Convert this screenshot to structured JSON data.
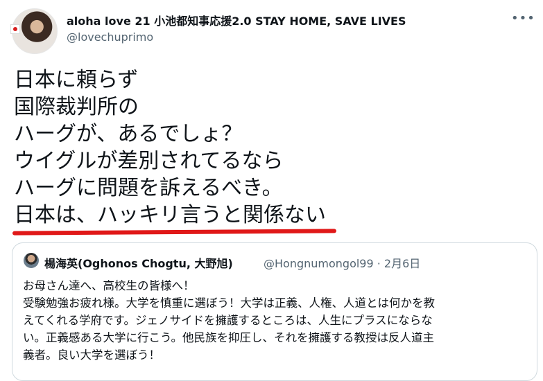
{
  "author": {
    "display_name": "aloha love 21 小池都知事応援2.0 STAY HOME, SAVE LIVES",
    "handle": "@lovechuprimo",
    "more_icon": "more-horizontal-icon"
  },
  "tweet": {
    "lines": [
      "日本に頼らず",
      "国際裁判所の",
      "ハーグが、あるでしょ？",
      "ウイグルが差別されてるなら",
      "ハーグに問題を訴えるべき。",
      "日本は、ハッキリ言うと関係ない"
    ],
    "underline_color": "#e01818"
  },
  "quoted": {
    "display_name": "楊海英(Oghonos Chogtu, 大野旭)",
    "meta": "@Hongnumongol99 · 2月6日",
    "lines": [
      "お母さん達へ、高校生の皆様へ！",
      "受験勉強お疲れ様。大学を慎重に選ぼう！大学は正義、人権、人道とは何かを教",
      "えてくれる学府です。ジェノサイドを擁護するところは、人生にプラスにならな",
      "い。正義感ある大学に行こう。他民族を抑圧し、それを擁護する教授は反人道主",
      "義者。良い大学を選ぼう！"
    ]
  },
  "colors": {
    "text": "#0f1419",
    "secondary": "#536471",
    "border": "#cfd9de"
  }
}
